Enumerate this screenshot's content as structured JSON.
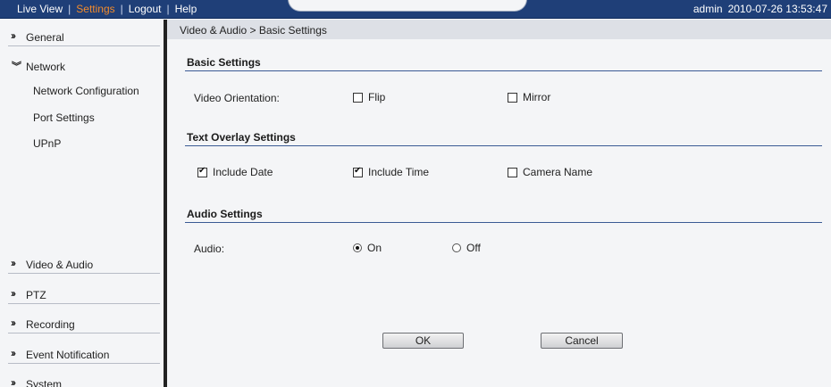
{
  "topbar": {
    "nav": [
      "Live View",
      "Settings",
      "Logout",
      "Help"
    ],
    "user": "admin",
    "datetime": "2010-07-26 13:53:47",
    "active_color": "#f08a2c"
  },
  "sidebar": {
    "sections": {
      "general": "General",
      "network": "Network",
      "video_audio": "Video & Audio",
      "ptz": "PTZ",
      "recording": "Recording",
      "event_notification": "Event Notification",
      "system": "System"
    },
    "network_items": [
      "Network Configuration",
      "Port Settings",
      "UPnP"
    ]
  },
  "breadcrumb": "Video & Audio > Basic Settings",
  "basic": {
    "title": "Basic Settings",
    "video_orientation_label": "Video Orientation:",
    "flip": {
      "label": "Flip",
      "checked": false
    },
    "mirror": {
      "label": "Mirror",
      "checked": false
    }
  },
  "overlay": {
    "title": "Text Overlay Settings",
    "include_date": {
      "label": "Include Date",
      "checked": true
    },
    "include_time": {
      "label": "Include Time",
      "checked": true
    },
    "camera_name": {
      "label": "Camera Name",
      "checked": false
    }
  },
  "audio": {
    "title": "Audio Settings",
    "label": "Audio:",
    "on": {
      "label": "On",
      "checked": true
    },
    "off": {
      "label": "Off",
      "checked": false
    }
  },
  "buttons": {
    "ok": "OK",
    "cancel": "Cancel"
  }
}
